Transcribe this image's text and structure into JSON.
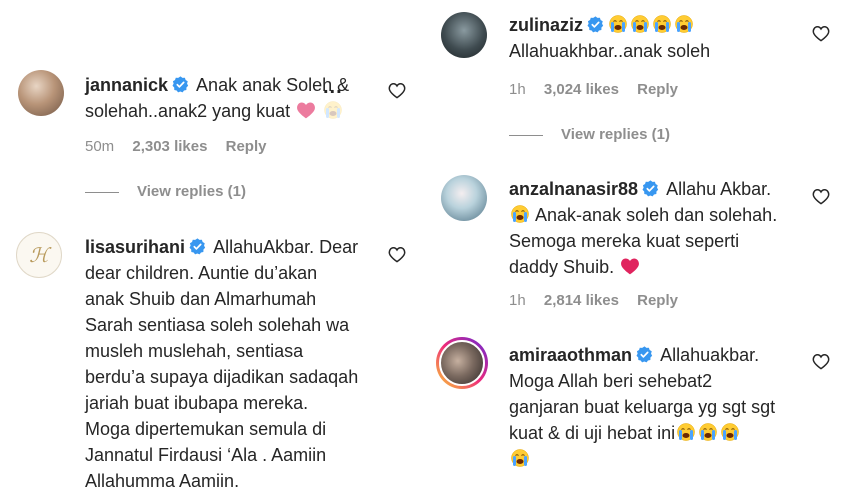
{
  "comments": [
    {
      "username": "jannanick",
      "text_lines": [
        "Anak anak Soleh &",
        "solehah..anak2 yang kuat"
      ],
      "time": "50m",
      "likes": "2,303 likes",
      "reply": "Reply",
      "view_replies": "View replies (1)",
      "more": "..."
    },
    {
      "username": "lisasurihani",
      "text_lines": [
        "AllahuAkbar. Dear",
        "dear children. Auntie du’akan",
        "anak Shuib dan Almarhumah",
        "Sarah sentiasa soleh solehah wa",
        "musleh muslehah, sentiasa",
        "berdu’a supaya dijadikan sadaqah",
        "jariah buat ibubapa mereka.",
        "Moga dipertemukan semula di",
        "Jannatul Firdausi ‘Ala . Aamiin",
        "Allahumma Aamiin."
      ]
    },
    {
      "username": "zulinaziz",
      "text_lines": [
        "Allahuakhbar..anak soleh"
      ],
      "time": "1h",
      "likes": "3,024 likes",
      "reply": "Reply",
      "view_replies": "View replies (1)"
    },
    {
      "username": "anzalnanasir88",
      "text_lines": [
        "Allahu Akbar.",
        "Anak-anak soleh dan solehah.",
        "Semoga mereka kuat seperti",
        "daddy Shuib."
      ],
      "time": "1h",
      "likes": "2,814 likes",
      "reply": "Reply"
    },
    {
      "username": "amiraaothman",
      "text_lines": [
        "Allahuakbar.",
        "Moga Allah beri sehebat2",
        "ganjaran buat keluarga yg sgt sgt",
        "kuat & di uji hebat ini"
      ]
    }
  ],
  "colors": {
    "verified": "#3897f0",
    "meta": "#8e8e8e",
    "text": "#262626"
  },
  "icons": [
    "verified-badge-icon",
    "heart-icon",
    "crying-emoji-icon",
    "red-heart-emoji-icon"
  ]
}
